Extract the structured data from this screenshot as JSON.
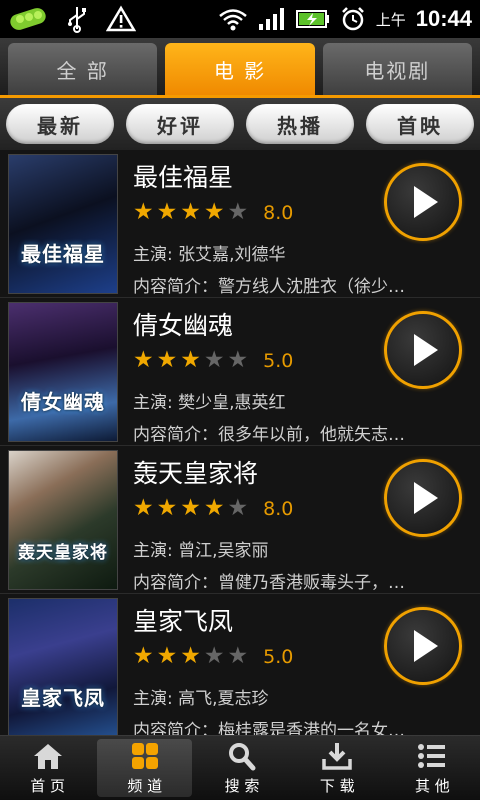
{
  "status_bar": {
    "ampm": "上午",
    "time": "10:44",
    "icons": [
      "pea-pod-icon",
      "usb-icon",
      "warning-icon",
      "wifi-icon",
      "signal-icon",
      "battery-charging-icon",
      "alarm-icon"
    ]
  },
  "top_tabs": [
    {
      "label": "全 部",
      "active": false
    },
    {
      "label": "电 影",
      "active": true
    },
    {
      "label": "电视剧",
      "active": false
    }
  ],
  "filters": [
    {
      "label": "最新",
      "active": true
    },
    {
      "label": "好评",
      "active": false
    },
    {
      "label": "热播",
      "active": false
    },
    {
      "label": "首映",
      "active": false
    }
  ],
  "movies": [
    {
      "title": "最佳福星",
      "rating": 4,
      "score": "8.0",
      "actors": "主演: 张艾嘉,刘德华",
      "summary": "内容简介：警方线人沈胜衣（徐少…",
      "poster_text": "最佳福星"
    },
    {
      "title": "倩女幽魂",
      "rating": 3,
      "score": "5.0",
      "actors": "主演: 樊少皇,惠英红",
      "summary": "内容简介：很多年以前，他就矢志…",
      "poster_text": "倩女幽魂"
    },
    {
      "title": "轰天皇家将",
      "rating": 4,
      "score": "8.0",
      "actors": "主演: 曾江,吴家丽",
      "summary": "内容简介：曾健乃香港贩毒头子，…",
      "poster_text": "轰天皇家将"
    },
    {
      "title": "皇家飞凤",
      "rating": 3,
      "score": "5.0",
      "actors": "主演: 高飞,夏志珍",
      "summary": "内容简介：梅桂露是香港的一名女…",
      "poster_text": "皇家飞凤"
    }
  ],
  "bottom_nav": [
    {
      "label": "首 页",
      "icon": "home-icon",
      "active": false
    },
    {
      "label": "频 道",
      "icon": "grid-icon",
      "active": true
    },
    {
      "label": "搜 索",
      "icon": "search-icon",
      "active": false
    },
    {
      "label": "下 载",
      "icon": "download-icon",
      "active": false
    },
    {
      "label": "其 他",
      "icon": "list-icon",
      "active": false
    }
  ],
  "colors": {
    "accent": "#f59a00",
    "star_on": "#f0a800",
    "star_off": "#666666"
  }
}
